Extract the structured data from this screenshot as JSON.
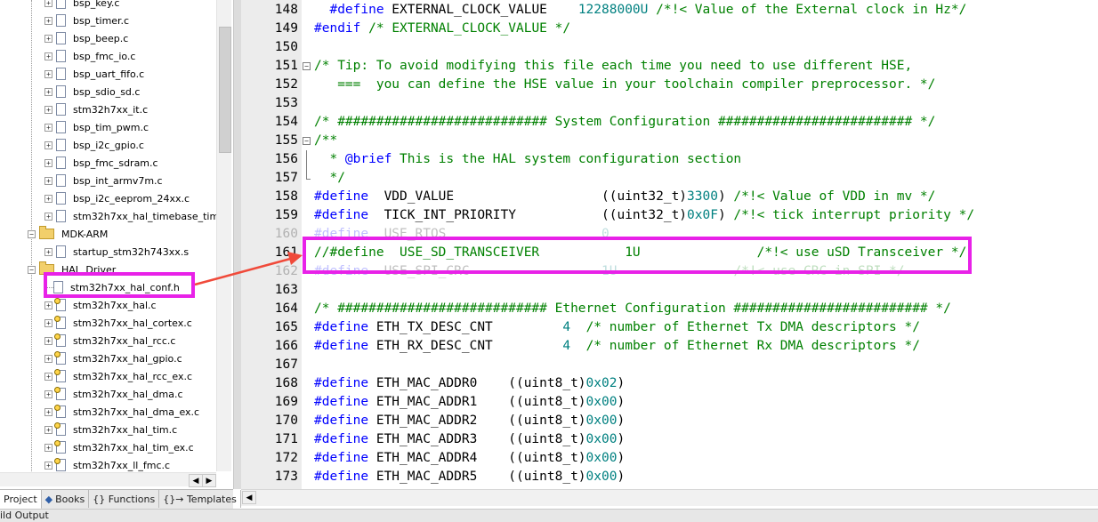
{
  "project_tree": {
    "items": [
      {
        "label": "bsp_key.c",
        "type": "file"
      },
      {
        "label": "bsp_timer.c",
        "type": "file"
      },
      {
        "label": "bsp_beep.c",
        "type": "file"
      },
      {
        "label": "bsp_fmc_io.c",
        "type": "file"
      },
      {
        "label": "bsp_uart_fifo.c",
        "type": "file"
      },
      {
        "label": "bsp_sdio_sd.c",
        "type": "file"
      },
      {
        "label": "stm32h7xx_it.c",
        "type": "file"
      },
      {
        "label": "bsp_tim_pwm.c",
        "type": "file"
      },
      {
        "label": "bsp_i2c_gpio.c",
        "type": "file"
      },
      {
        "label": "bsp_fmc_sdram.c",
        "type": "file"
      },
      {
        "label": "bsp_int_armv7m.c",
        "type": "file"
      },
      {
        "label": "bsp_i2c_eeprom_24xx.c",
        "type": "file"
      },
      {
        "label": "stm32h7xx_hal_timebase_tim.",
        "type": "file"
      },
      {
        "label": "MDK-ARM",
        "type": "folder"
      },
      {
        "label": "startup_stm32h743xx.s",
        "type": "file"
      },
      {
        "label": "HAL_Driver",
        "type": "folder"
      },
      {
        "label": "stm32h7xx_hal_conf.h",
        "type": "header"
      },
      {
        "label": "stm32h7xx_hal.c",
        "type": "keyfile"
      },
      {
        "label": "stm32h7xx_hal_cortex.c",
        "type": "keyfile"
      },
      {
        "label": "stm32h7xx_hal_rcc.c",
        "type": "keyfile"
      },
      {
        "label": "stm32h7xx_hal_gpio.c",
        "type": "keyfile"
      },
      {
        "label": "stm32h7xx_hal_rcc_ex.c",
        "type": "keyfile"
      },
      {
        "label": "stm32h7xx_hal_dma.c",
        "type": "keyfile"
      },
      {
        "label": "stm32h7xx_hal_dma_ex.c",
        "type": "keyfile"
      },
      {
        "label": "stm32h7xx_hal_tim.c",
        "type": "keyfile"
      },
      {
        "label": "stm32h7xx_hal_tim_ex.c",
        "type": "keyfile"
      },
      {
        "label": "stm32h7xx_ll_fmc.c",
        "type": "keyfile"
      }
    ]
  },
  "tabs": [
    {
      "label": "Project",
      "icon": "project-icon",
      "active": true
    },
    {
      "label": "Books",
      "icon": "books-icon",
      "active": false
    },
    {
      "label": "{} Functions",
      "icon": "functions-icon",
      "active": false
    },
    {
      "label": "{}→ Templates",
      "icon": "templates-icon",
      "active": false
    }
  ],
  "build_output": {
    "label": "ild Output"
  },
  "editor": {
    "lines": [
      {
        "n": "148",
        "fold": "",
        "segs": [
          [
            "tx",
            "  "
          ],
          [
            "kw",
            "#define"
          ],
          [
            "tx",
            " EXTERNAL_CLOCK_VALUE    "
          ],
          [
            "num",
            "12288000U"
          ],
          [
            "tx",
            " "
          ],
          [
            "cm",
            "/*!< Value of the External clock in Hz*/"
          ]
        ]
      },
      {
        "n": "149",
        "fold": "",
        "segs": [
          [
            "kw",
            "#endif"
          ],
          [
            "tx",
            " "
          ],
          [
            "cm",
            "/* EXTERNAL_CLOCK_VALUE */"
          ]
        ]
      },
      {
        "n": "150",
        "fold": "",
        "segs": []
      },
      {
        "n": "151",
        "fold": "box",
        "segs": [
          [
            "cm",
            "/* Tip: To avoid modifying this file each time you need to use different HSE,"
          ]
        ]
      },
      {
        "n": "152",
        "fold": "",
        "segs": [
          [
            "cm",
            "   ===  you can define the HSE value in your toolchain compiler preprocessor. */"
          ]
        ]
      },
      {
        "n": "153",
        "fold": "",
        "segs": []
      },
      {
        "n": "154",
        "fold": "",
        "segs": [
          [
            "cm",
            "/* ########################### System Configuration ######################### */"
          ]
        ]
      },
      {
        "n": "155",
        "fold": "box",
        "segs": [
          [
            "cm",
            "/**"
          ]
        ]
      },
      {
        "n": "156",
        "fold": "line",
        "segs": [
          [
            "cm",
            "  * "
          ],
          [
            "kw",
            "@brief"
          ],
          [
            "cm",
            " This is the HAL system configuration section"
          ]
        ]
      },
      {
        "n": "157",
        "fold": "end",
        "segs": [
          [
            "cm",
            "  */"
          ]
        ]
      },
      {
        "n": "158",
        "fold": "",
        "segs": [
          [
            "kw",
            "#define"
          ],
          [
            "tx",
            "  VDD_VALUE                   ((uint32_t)"
          ],
          [
            "num",
            "3300"
          ],
          [
            "tx",
            ") "
          ],
          [
            "cm",
            "/*!< Value of VDD in mv */"
          ]
        ]
      },
      {
        "n": "159",
        "fold": "",
        "segs": [
          [
            "kw",
            "#define"
          ],
          [
            "tx",
            "  TICK_INT_PRIORITY           ((uint32_t)"
          ],
          [
            "num",
            "0x0F"
          ],
          [
            "tx",
            ") "
          ],
          [
            "cm",
            "/*!< tick interrupt priority */"
          ]
        ]
      },
      {
        "n": "160",
        "fold": "",
        "segs": [
          [
            "kw",
            "#define"
          ],
          [
            "tx",
            "  USE_RTOS                    "
          ],
          [
            "num",
            "0"
          ]
        ]
      },
      {
        "n": "161",
        "fold": "",
        "segs": [
          [
            "cm",
            "//#define  USE_SD_TRANSCEIVER           1U               /*!< use uSD Transceiver */"
          ]
        ]
      },
      {
        "n": "162",
        "fold": "",
        "segs": [
          [
            "kw",
            "#define"
          ],
          [
            "tx",
            "  USE_SPI_CRC                 "
          ],
          [
            "num",
            "1U"
          ],
          [
            "tx",
            "               "
          ],
          [
            "cm",
            "/*!< use CRC in SPI */"
          ]
        ]
      },
      {
        "n": "163",
        "fold": "",
        "segs": []
      },
      {
        "n": "164",
        "fold": "",
        "segs": [
          [
            "cm",
            "/* ########################### Ethernet Configuration ######################### */"
          ]
        ]
      },
      {
        "n": "165",
        "fold": "",
        "segs": [
          [
            "kw",
            "#define"
          ],
          [
            "tx",
            " ETH_TX_DESC_CNT         "
          ],
          [
            "num",
            "4"
          ],
          [
            "tx",
            "  "
          ],
          [
            "cm",
            "/* number of Ethernet Tx DMA descriptors */"
          ]
        ]
      },
      {
        "n": "166",
        "fold": "",
        "segs": [
          [
            "kw",
            "#define"
          ],
          [
            "tx",
            " ETH_RX_DESC_CNT         "
          ],
          [
            "num",
            "4"
          ],
          [
            "tx",
            "  "
          ],
          [
            "cm",
            "/* number of Ethernet Rx DMA descriptors */"
          ]
        ]
      },
      {
        "n": "167",
        "fold": "",
        "segs": []
      },
      {
        "n": "168",
        "fold": "",
        "segs": [
          [
            "kw",
            "#define"
          ],
          [
            "tx",
            " ETH_MAC_ADDR0    ((uint8_t)"
          ],
          [
            "num",
            "0x02"
          ],
          [
            "tx",
            ")"
          ]
        ]
      },
      {
        "n": "169",
        "fold": "",
        "segs": [
          [
            "kw",
            "#define"
          ],
          [
            "tx",
            " ETH_MAC_ADDR1    ((uint8_t)"
          ],
          [
            "num",
            "0x00"
          ],
          [
            "tx",
            ")"
          ]
        ]
      },
      {
        "n": "170",
        "fold": "",
        "segs": [
          [
            "kw",
            "#define"
          ],
          [
            "tx",
            " ETH_MAC_ADDR2    ((uint8_t)"
          ],
          [
            "num",
            "0x00"
          ],
          [
            "tx",
            ")"
          ]
        ]
      },
      {
        "n": "171",
        "fold": "",
        "segs": [
          [
            "kw",
            "#define"
          ],
          [
            "tx",
            " ETH_MAC_ADDR3    ((uint8_t)"
          ],
          [
            "num",
            "0x00"
          ],
          [
            "tx",
            ")"
          ]
        ]
      },
      {
        "n": "172",
        "fold": "",
        "segs": [
          [
            "kw",
            "#define"
          ],
          [
            "tx",
            " ETH_MAC_ADDR4    ((uint8_t)"
          ],
          [
            "num",
            "0x00"
          ],
          [
            "tx",
            ")"
          ]
        ]
      },
      {
        "n": "173",
        "fold": "",
        "segs": [
          [
            "kw",
            "#define"
          ],
          [
            "tx",
            " ETH_MAC_ADDR5    ((uint8_t)"
          ],
          [
            "num",
            "0x00"
          ],
          [
            "tx",
            ")"
          ]
        ]
      }
    ]
  },
  "annotations": {
    "highlight_color": "#e821e8",
    "arrow_color": "#f04a3a"
  },
  "colors": {
    "keyword": "#0000ff",
    "comment": "#008000",
    "number": "#008080",
    "gutter": "#ececec"
  }
}
